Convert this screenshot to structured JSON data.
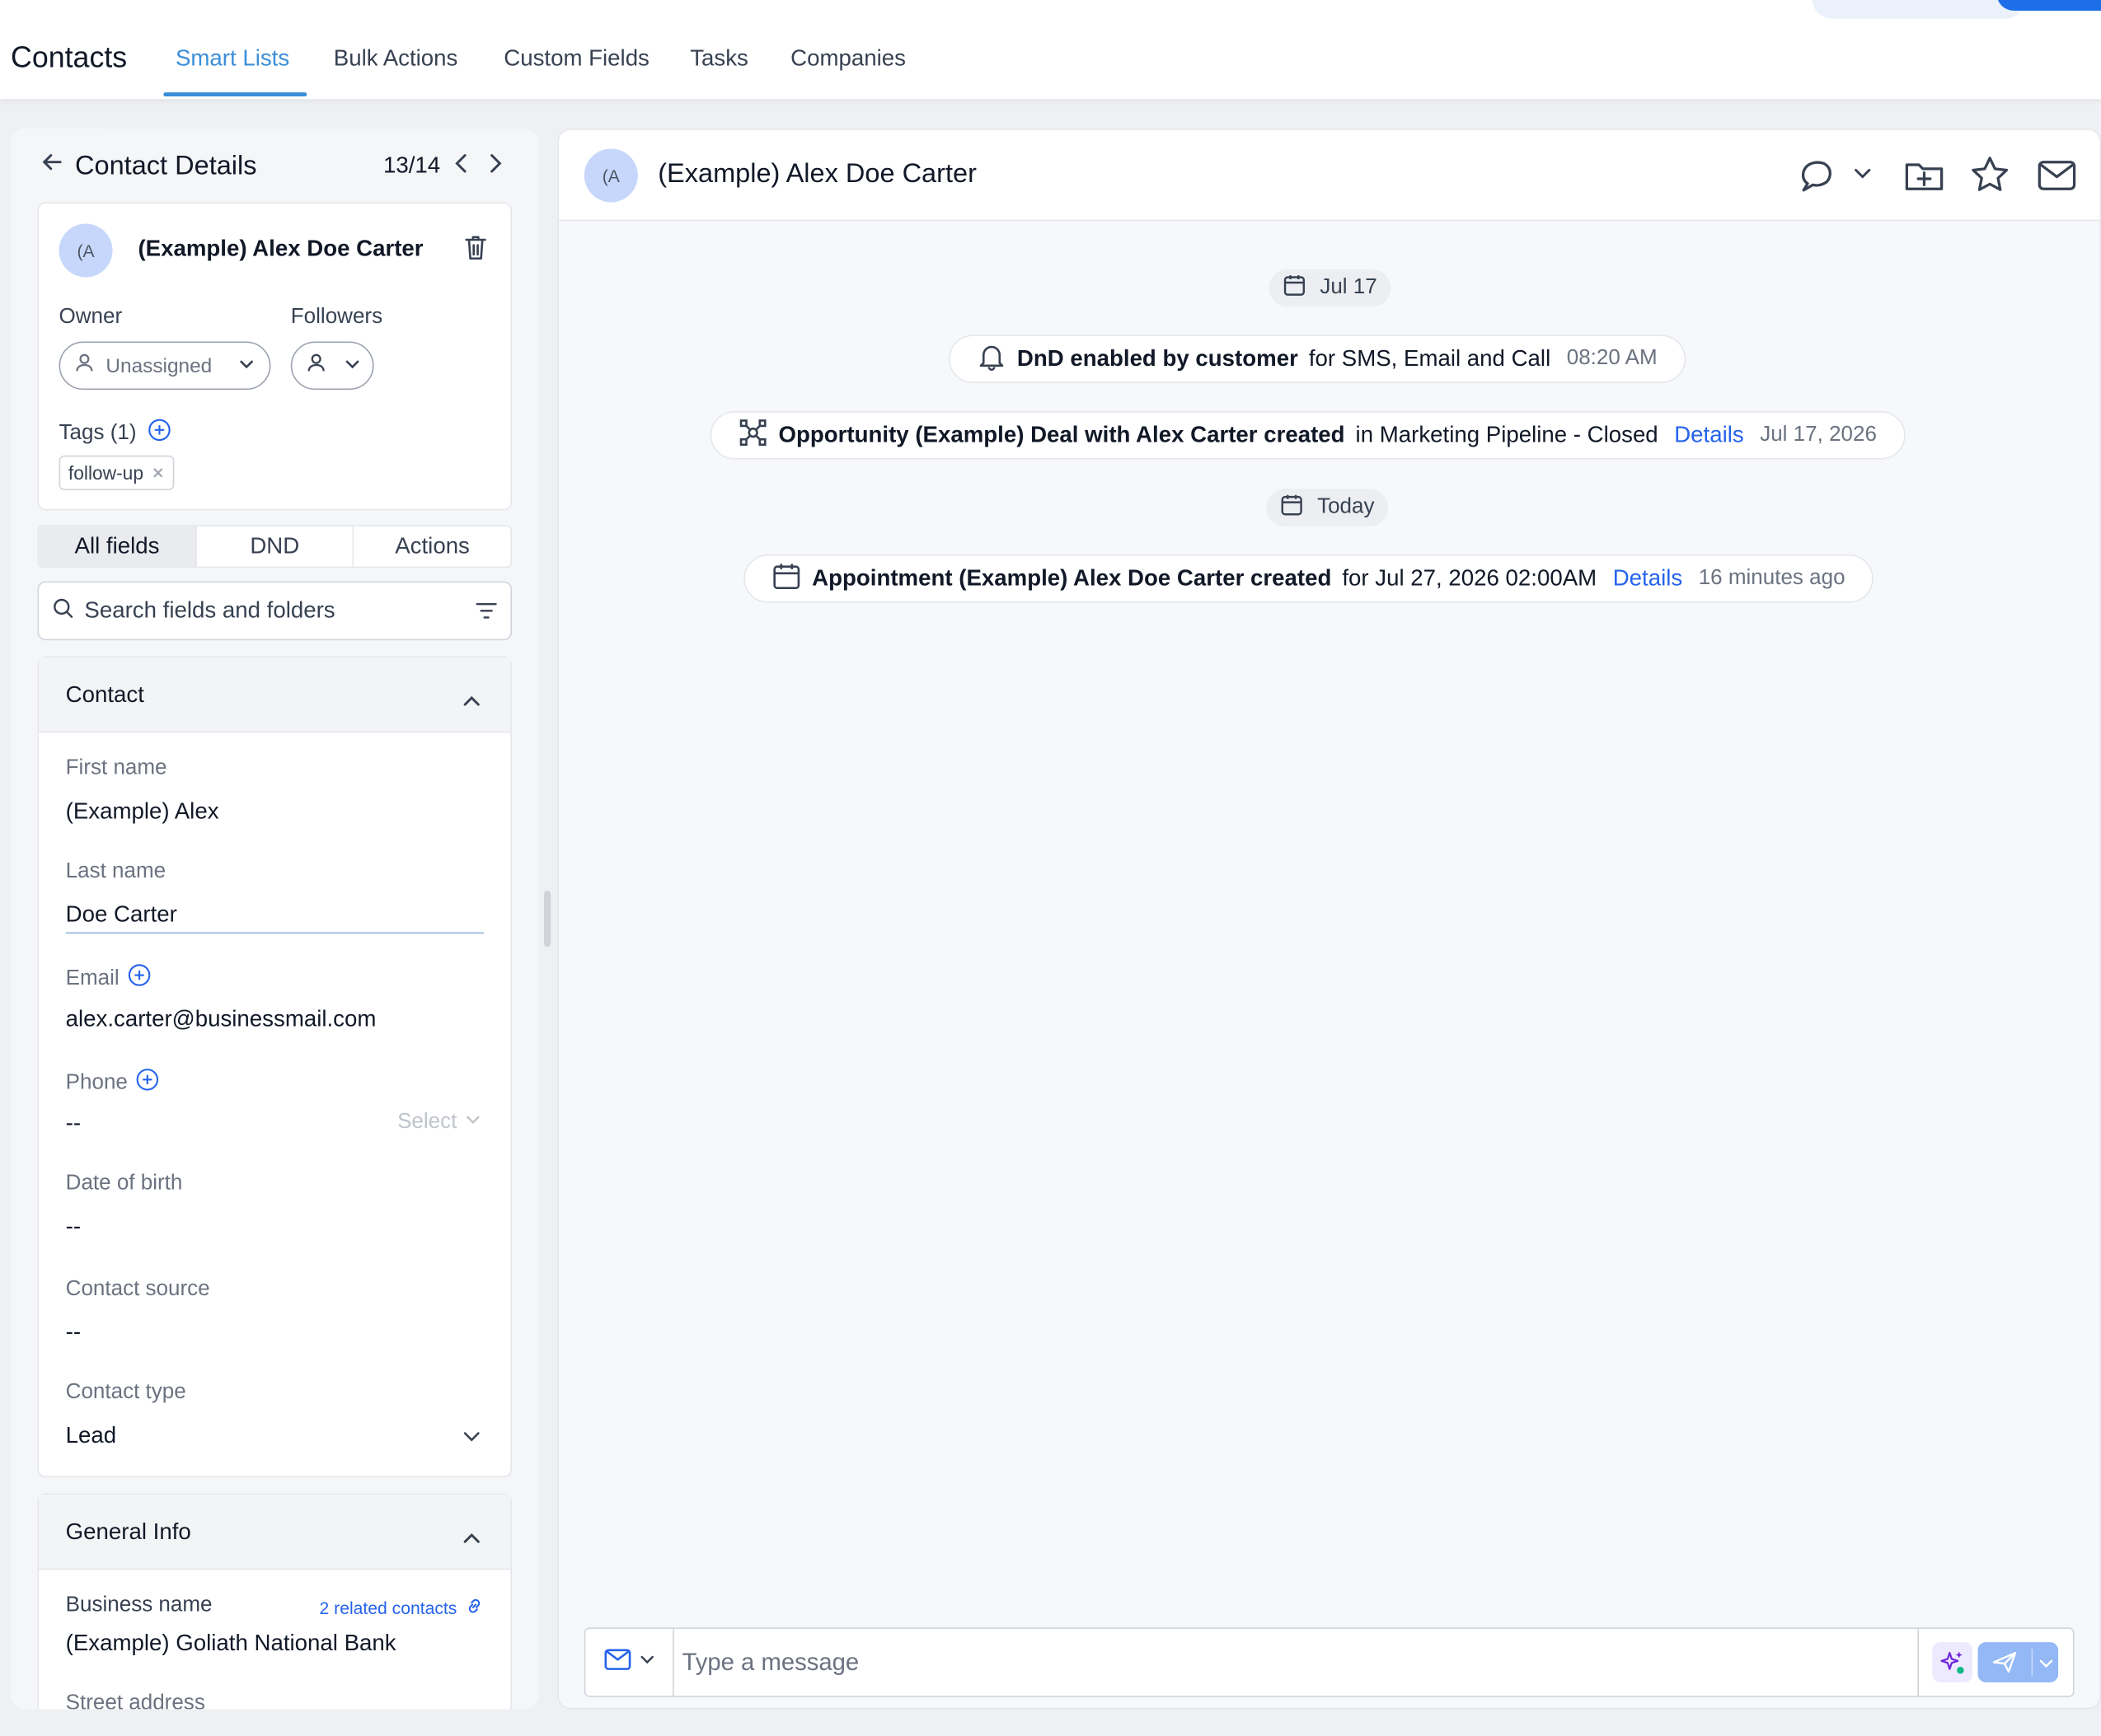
{
  "nav": {
    "title": "Contacts",
    "tabs": [
      {
        "label": "Smart Lists",
        "active": true
      },
      {
        "label": "Bulk Actions"
      },
      {
        "label": "Custom Fields"
      },
      {
        "label": "Tasks"
      },
      {
        "label": "Companies"
      }
    ]
  },
  "left": {
    "header": "Contact Details",
    "counter": "13/14",
    "card": {
      "avatar": "(A",
      "name": "(Example) Alex Doe Carter",
      "owner_label": "Owner",
      "owner_value": "Unassigned",
      "followers_label": "Followers",
      "tags_label": "Tags (1)",
      "tag": "follow-up"
    },
    "segments": [
      "All fields",
      "DND",
      "Actions"
    ],
    "search_placeholder": "Search fields and folders",
    "contact_section": {
      "title": "Contact",
      "first_name_label": "First name",
      "first_name": "(Example) Alex",
      "last_name_label": "Last name",
      "last_name": "Doe Carter",
      "email_label": "Email",
      "email": "alex.carter@businessmail.com",
      "phone_label": "Phone",
      "phone": "--",
      "phone_select": "Select",
      "dob_label": "Date of birth",
      "dob": "--",
      "source_label": "Contact source",
      "source": "--",
      "type_label": "Contact type",
      "type": "Lead"
    },
    "general_section": {
      "title": "General Info",
      "business_label": "Business name",
      "related": "2 related contacts",
      "business": "(Example) Goliath National Bank",
      "street_label": "Street address"
    }
  },
  "right": {
    "avatar": "(A",
    "name": "(Example) Alex Doe Carter",
    "date1": "Jul 17",
    "event1": {
      "bold": "DnD enabled by customer",
      "rest": "for SMS, Email and Call",
      "time": "08:20 AM"
    },
    "event2": {
      "bold": "Opportunity (Example) Deal with Alex Carter created",
      "rest": "in Marketing Pipeline - Closed",
      "link": "Details",
      "time": "Jul 17, 2026"
    },
    "date2": "Today",
    "event3": {
      "bold": "Appointment (Example) Alex Doe Carter created",
      "rest": "for Jul 27, 2026 02:00AM",
      "link": "Details",
      "time": "16 minutes ago"
    },
    "composer_placeholder": "Type a message"
  },
  "colors": {
    "accent": "#3b8ed8",
    "link": "#2563eb",
    "avatar_bg": "#c7d7fb"
  }
}
